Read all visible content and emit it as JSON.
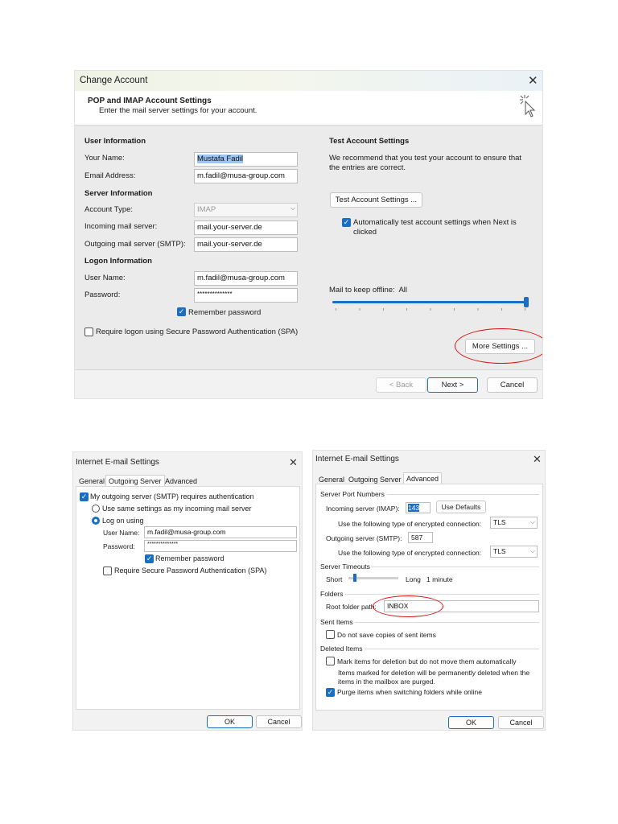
{
  "change_account": {
    "title": "Change Account",
    "header_title": "POP and IMAP Account Settings",
    "header_subtitle": "Enter the mail server settings for your account.",
    "user_info_heading": "User Information",
    "your_name_label": "Your Name:",
    "your_name_value": "Mustafa Fadil",
    "email_label": "Email Address:",
    "email_value": "m.fadil@musa-group.com",
    "server_info_heading": "Server Information",
    "account_type_label": "Account Type:",
    "account_type_value": "IMAP",
    "incoming_label": "Incoming mail server:",
    "incoming_value": "mail.your-server.de",
    "outgoing_label": "Outgoing mail server (SMTP):",
    "outgoing_value": "mail.your-server.de",
    "logon_info_heading": "Logon Information",
    "username_label": "User Name:",
    "username_value": "m.fadil@musa-group.com",
    "password_label": "Password:",
    "password_value": "**************",
    "remember_password_label": "Remember password",
    "spa_label": "Require logon using Secure Password Authentication (SPA)",
    "test_heading": "Test Account Settings",
    "test_description_1": "We recommend that you test your account to ensure that",
    "test_description_2": "the entries are correct.",
    "test_button": "Test Account Settings ...",
    "auto_test_label_1": "Automatically test account settings when Next is",
    "auto_test_label_2": "clicked",
    "offline_label": "Mail to keep offline:",
    "offline_value": "All",
    "offline_slider_level": 1.0,
    "more_settings_button": "More Settings ...",
    "back_button": "< Back",
    "next_button": "Next >",
    "cancel_button": "Cancel"
  },
  "outgoing_dialog": {
    "title": "Internet E-mail Settings",
    "tabs": [
      "General",
      "Outgoing Server",
      "Advanced"
    ],
    "smtp_auth_label": "My outgoing server (SMTP) requires authentication",
    "same_settings_label": "Use same settings as my incoming mail server",
    "log_on_using_label": "Log on using",
    "username_label": "User Name:",
    "username_value": "m.fadil@musa-group.com",
    "password_label": "Password:",
    "password_value": "**************",
    "remember_password_label": "Remember password",
    "spa_label": "Require Secure Password Authentication (SPA)",
    "ok_button": "OK",
    "cancel_button": "Cancel"
  },
  "advanced_dialog": {
    "title": "Internet E-mail Settings",
    "tabs": [
      "General",
      "Outgoing Server",
      "Advanced"
    ],
    "server_ports_heading": "Server Port Numbers",
    "incoming_label": "Incoming server (IMAP):",
    "incoming_port": "143",
    "use_defaults_button": "Use Defaults",
    "encrypted_label": "Use the following type of encrypted connection:",
    "incoming_encryption": "TLS",
    "outgoing_label": "Outgoing server (SMTP):",
    "outgoing_port": "587",
    "outgoing_encryption": "TLS",
    "timeouts_heading": "Server Timeouts",
    "short_label": "Short",
    "long_label": "Long",
    "timeout_value": "1 minute",
    "timeout_slider_level": 0.1,
    "folders_heading": "Folders",
    "root_folder_label": "Root folder path:",
    "root_folder_value": "INBOX",
    "sent_items_heading": "Sent Items",
    "do_not_save_label": "Do not save copies of sent items",
    "deleted_items_heading": "Deleted Items",
    "mark_deletion_label": "Mark items for deletion but do not move them automatically",
    "mark_deletion_note_1": "Items marked for deletion will be permanently deleted when the",
    "mark_deletion_note_2": "items in the mailbox are purged.",
    "purge_label": "Purge items when switching folders while online",
    "ok_button": "OK",
    "cancel_button": "Cancel"
  },
  "colors": {
    "accent": "#1a6fc4",
    "annotation": "#d11111",
    "dialog_bg": "#f3f3f3"
  }
}
